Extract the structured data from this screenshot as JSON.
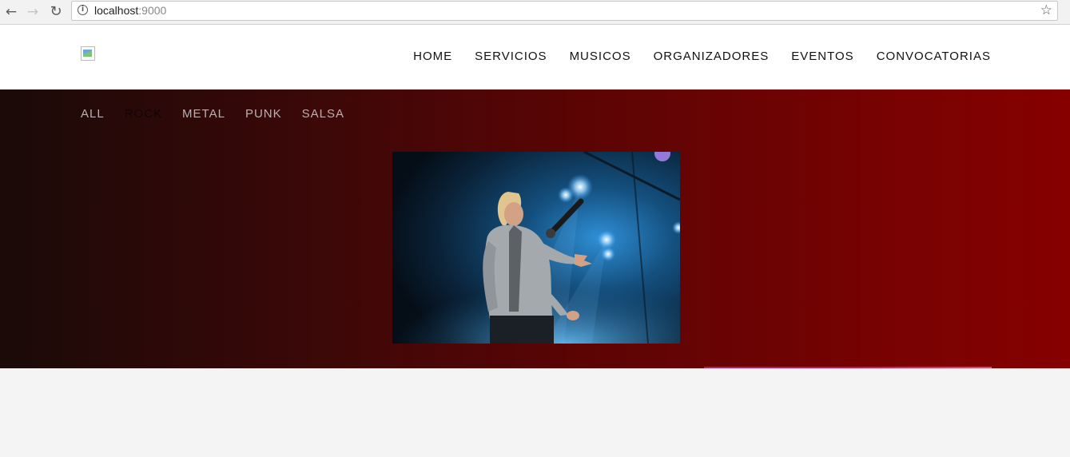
{
  "browser": {
    "url_host": "localhost",
    "url_port": ":9000"
  },
  "header": {
    "nav": [
      "HOME",
      "SERVICIOS",
      "MUSICOS",
      "ORGANIZADORES",
      "EVENTOS",
      "CONVOCATORIAS"
    ]
  },
  "hero": {
    "filters": [
      "ALL",
      "ROCK",
      "METAL",
      "PUNK",
      "SALSA"
    ],
    "active_filter": "ROCK"
  },
  "colors": {
    "hero_start": "#1a0a08",
    "hero_end": "#860000",
    "page_bg": "#f4f4f4"
  }
}
